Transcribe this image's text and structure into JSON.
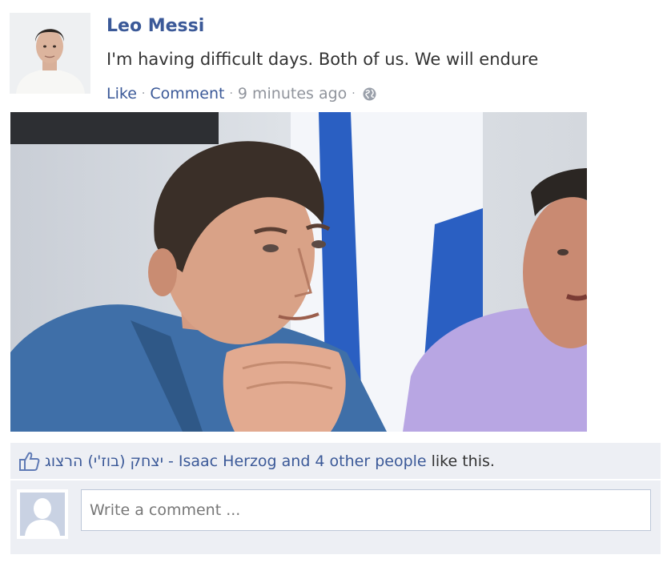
{
  "post": {
    "author": "Leo Messi",
    "status": "I'm having difficult days. Both of us. We will endure",
    "actions": {
      "like": "Like",
      "comment": "Comment",
      "timestamp": "9 minutes ago",
      "separator": "·"
    }
  },
  "likes": {
    "liker_link": "יצחק (בוז'י) הרצוג - Isaac Herzog and 4 other people",
    "suffix": "like this."
  },
  "comment_input": {
    "placeholder": "Write a comment ..."
  },
  "icons": {
    "globe": "globe-icon",
    "like": "thumbs-up-icon",
    "avatar_placeholder": "default-user-icon"
  },
  "colors": {
    "link": "#3b5998",
    "muted": "#90949c",
    "panel": "#edeff4"
  }
}
